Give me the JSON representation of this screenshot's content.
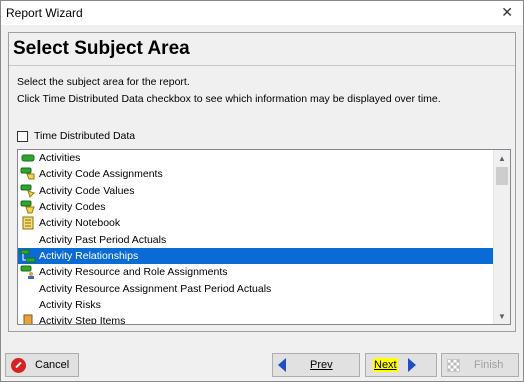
{
  "window": {
    "title": "Report Wizard",
    "close_glyph": "✕"
  },
  "page": {
    "heading": "Select Subject Area",
    "description_line1": "Select the subject area for the report.",
    "description_line2": "Click Time Distributed Data checkbox to see which information may be displayed over time.",
    "time_distributed_label": "Time Distributed Data",
    "time_distributed_checked": false
  },
  "list": {
    "selected_index": 6,
    "items": [
      {
        "label": "Activities",
        "icon": "activity-bar-icon"
      },
      {
        "label": "Activity Code Assignments",
        "icon": "activity-code-assignment-icon"
      },
      {
        "label": "Activity Code Values",
        "icon": "activity-code-value-icon"
      },
      {
        "label": "Activity Codes",
        "icon": "activity-code-icon"
      },
      {
        "label": "Activity Notebook",
        "icon": "notebook-icon"
      },
      {
        "label": "Activity Past Period Actuals",
        "icon": ""
      },
      {
        "label": "Activity Relationships",
        "icon": "relationship-icon"
      },
      {
        "label": "Activity Resource and Role Assignments",
        "icon": "resource-assignment-icon"
      },
      {
        "label": "Activity Resource Assignment Past Period Actuals",
        "icon": ""
      },
      {
        "label": "Activity Risks",
        "icon": ""
      },
      {
        "label": "Activity Step Items",
        "icon": "step-items-icon"
      }
    ]
  },
  "buttons": {
    "cancel": "Cancel",
    "prev": "Prev",
    "next": "Next",
    "finish": "Finish"
  },
  "colors": {
    "selection": "#0a6ad6",
    "highlight": "#ffff00",
    "nav_arrow": "#1d4fbf",
    "cancel_icon": "#d92121"
  }
}
